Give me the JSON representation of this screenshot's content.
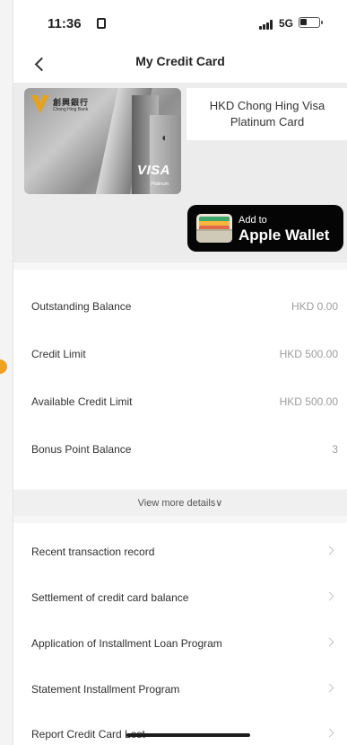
{
  "status_bar": {
    "time": "11:36",
    "network": "5G"
  },
  "header": {
    "title": "My Credit Card"
  },
  "card": {
    "name": "HKD Chong Hing Visa Platinum Card",
    "bank_name_cn": "創興銀行",
    "bank_name_en": "Chong Hing Bank",
    "network_logo": "VISA",
    "tier_text": "Platinum"
  },
  "apple_wallet": {
    "line1": "Add to",
    "line2": "Apple Wallet"
  },
  "account_summary": [
    {
      "label": "Outstanding Balance",
      "value": "HKD 0.00"
    },
    {
      "label": "Credit Limit",
      "value": "HKD 500.00"
    },
    {
      "label": "Available Credit Limit",
      "value": "HKD 500.00"
    },
    {
      "label": "Bonus Point Balance",
      "value": "3"
    }
  ],
  "details": {
    "view_more": "View more details∨"
  },
  "menu": [
    {
      "label": "Recent transaction record"
    },
    {
      "label": "Settlement of credit card balance"
    },
    {
      "label": "Application of Installment Loan Program"
    },
    {
      "label": "Statement Installment Program"
    },
    {
      "label": "Report Credit Card Lost"
    }
  ],
  "icons": {
    "back": "chevron-left-icon",
    "menu_arrow": "chevron-right-icon",
    "wallet": "wallet-icon"
  },
  "colors": {
    "accent": "#f2a11f",
    "wallet_button": "#050505",
    "value_text": "#9d9d9d",
    "page_background": "#f6f6f6"
  }
}
